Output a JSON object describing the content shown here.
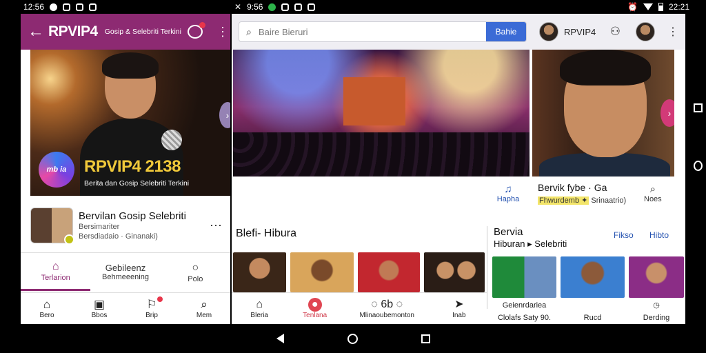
{
  "status": {
    "left_time": "12:56",
    "mid_time": "9:56",
    "right_time": "22:21"
  },
  "left_app": {
    "brand": "RPVIP4",
    "brand_sub": "Gosip & Selebriti Terkini",
    "hero": {
      "logo": "mb ia",
      "title": "RPVIP4 2138",
      "subtitle": "Berita dan Gosip Selebriti Terkini"
    },
    "feed_item": {
      "title": "Bervilan Gosip Selebriti",
      "meta1": "Bersimariter",
      "meta2": "Bersdiadaio · Ginanaki)"
    },
    "tabs": [
      {
        "icon": "home-icon",
        "glyph": "⌂",
        "label": "Terlarion"
      },
      {
        "icon": "",
        "glyph": "",
        "title": "Gebileenz",
        "label": "Behmeeening"
      },
      {
        "icon": "circle-icon",
        "glyph": "○",
        "label": "Polo"
      }
    ],
    "nav": [
      {
        "icon": "home-icon",
        "glyph": "⌂",
        "label": "Bero"
      },
      {
        "icon": "video-icon",
        "glyph": "▣",
        "label": "Bbos"
      },
      {
        "icon": "bell-icon",
        "glyph": "⚐",
        "label": "Brip"
      },
      {
        "icon": "search-icon",
        "glyph": "⌕",
        "label": "Mem"
      }
    ]
  },
  "right_app": {
    "search_placeholder": "Baire Bieruri",
    "search_button": "Bahie",
    "user_name": "RPVIP4",
    "actions": [
      {
        "icon": "music-icon",
        "glyph": "♫",
        "label": "Hapha"
      },
      {
        "icon": "search-icon",
        "glyph": "⌕",
        "label": "Noes"
      }
    ],
    "news_title": "Bervik fybe · Ga",
    "news_tag1": "Fhwurdemb ✦",
    "news_tag2": "Srinaatrio)",
    "section_left": "Blefi- Hibura",
    "section_right_title": "Bervia",
    "section_right_sub": "Hiburan ▸ Selebriti",
    "right_links": [
      "Fikso",
      "Hibto"
    ],
    "cards": [
      {
        "line1": "Geienrdariea",
        "line2": "Clolafs Saty 90."
      },
      {
        "line1": "",
        "line2": "Rucd"
      },
      {
        "line1": "",
        "line2": "Derding"
      }
    ],
    "nav": [
      {
        "icon": "home-icon",
        "glyph": "⌂",
        "label": "Bleria"
      },
      {
        "icon": "trending-icon",
        "glyph": "●",
        "label": "Tenlana"
      },
      {
        "icon": "chat-icon",
        "glyph": "◌ 6b ◌",
        "label": "Mlinaoubemonton"
      },
      {
        "icon": "share-icon",
        "glyph": "➤",
        "label": "Inab"
      }
    ]
  }
}
